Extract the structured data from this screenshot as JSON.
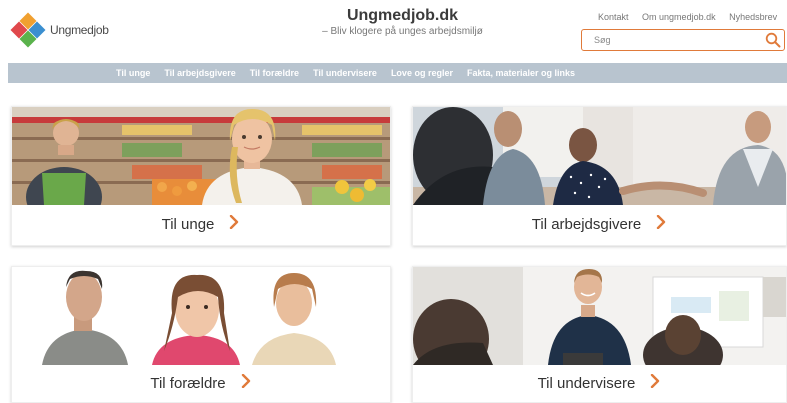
{
  "header": {
    "logo_text": "Ungmedjob",
    "site_title": "Ungmedjob.dk",
    "tagline": "– Bliv klogere på unges arbejdsmiljø",
    "top_links": [
      "Kontakt",
      "Om ungmedjob.dk",
      "Nyhedsbrev"
    ]
  },
  "search": {
    "placeholder": "Søg"
  },
  "nav": {
    "items": [
      "Til unge",
      "Til arbejdsgivere",
      "Til forældre",
      "Til undervisere",
      "Love og regler",
      "Fakta, materialer og links"
    ]
  },
  "cards": [
    {
      "label": "Til unge"
    },
    {
      "label": "Til arbejdsgivere"
    },
    {
      "label": "Til forældre"
    },
    {
      "label": "Til undervisere"
    }
  ],
  "colors": {
    "accent": "#e07a3a",
    "nav_background": "#b8c4cf",
    "title_text": "#3b3b3b"
  },
  "icons": {
    "search": "search-icon",
    "card_arrow": "chevron-right-icon"
  }
}
